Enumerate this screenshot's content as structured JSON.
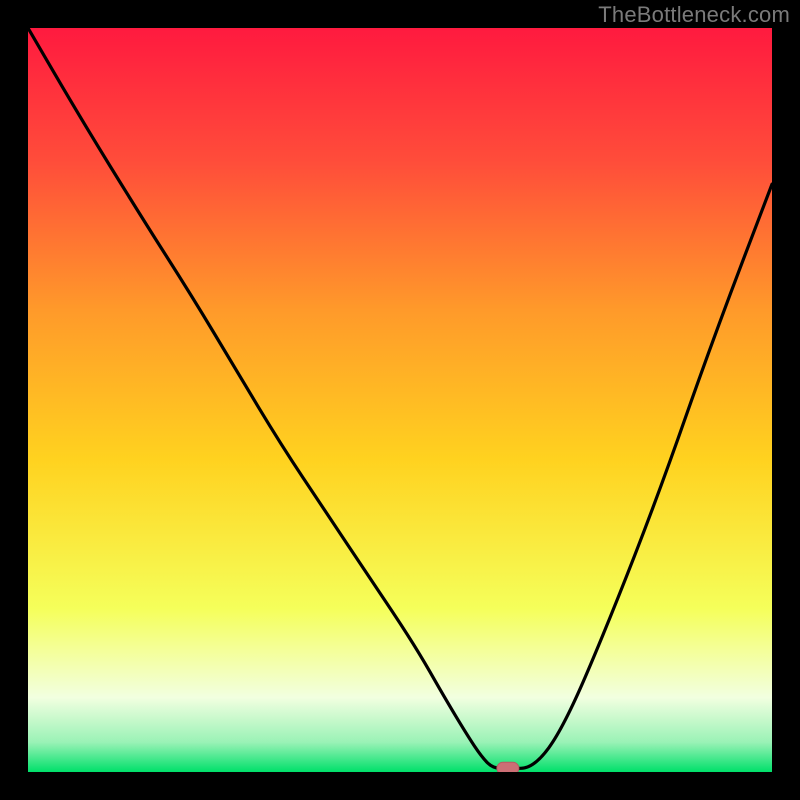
{
  "watermark": "TheBottleneck.com",
  "colors": {
    "frame_bg": "#000000",
    "gradient_top": "#ff1a3f",
    "gradient_mid_upper": "#ff7a2a",
    "gradient_mid": "#ffd21f",
    "gradient_mid_lower": "#f5ff5a",
    "gradient_pale": "#f2ffe0",
    "gradient_bottom": "#00e06a",
    "curve": "#000000",
    "marker_fill": "#cc6f75",
    "marker_stroke": "#b85a63"
  },
  "chart_data": {
    "type": "line",
    "title": "",
    "xlabel": "",
    "ylabel": "",
    "xlim": [
      0,
      100
    ],
    "ylim": [
      0,
      100
    ],
    "annotations": [
      {
        "name": "watermark",
        "text": "TheBottleneck.com"
      }
    ],
    "series": [
      {
        "name": "bottleneck-curve",
        "x": [
          0,
          7,
          15,
          22,
          28,
          34,
          40,
          46,
          52,
          56,
          59,
          61,
          62.5,
          64.5,
          68,
          72,
          78,
          85,
          92,
          100
        ],
        "y": [
          100,
          88,
          75,
          64,
          54,
          44,
          35,
          26,
          17,
          10,
          5,
          2,
          0.5,
          0.5,
          0.5,
          6,
          20,
          38,
          58,
          79
        ]
      }
    ],
    "marker": {
      "x": 64.5,
      "y": 0.5,
      "shape": "rounded-rect"
    }
  }
}
